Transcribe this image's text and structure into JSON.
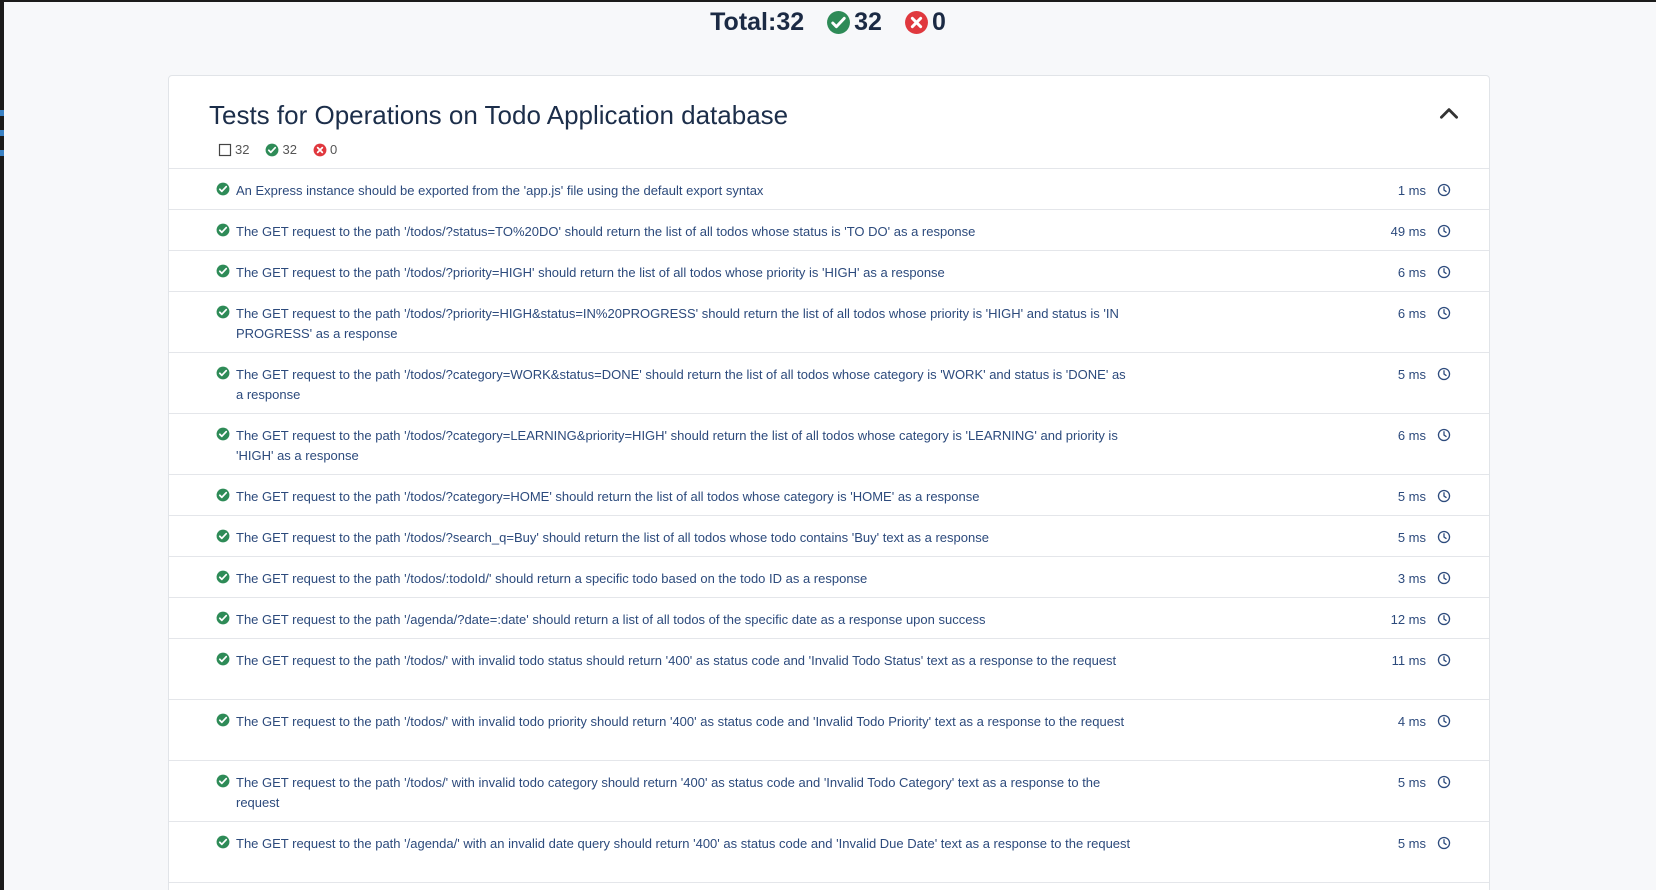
{
  "summary": {
    "total_label": "Total:32",
    "passed": "32",
    "failed": "0"
  },
  "suite": {
    "title": "Tests for Operations on Todo Application database",
    "stats": {
      "total": "32",
      "passed": "32",
      "failed": "0"
    }
  },
  "colors": {
    "pass": "#2e8b57",
    "fail": "#e0383e",
    "title_text": "#1c2e4a",
    "test_text": "#2c4a7c"
  },
  "icons": {
    "pass": "check-circle-icon",
    "fail": "x-circle-icon",
    "total": "square-icon",
    "duration": "clock-icon",
    "collapse": "chevron-up-icon"
  },
  "tests": [
    {
      "title": "An Express instance should be exported from the 'app.js' file using the default export syntax",
      "duration": "1 ms"
    },
    {
      "title": "The GET request to the path '/todos/?status=TO%20DO' should return the list of all todos whose status is 'TO DO' as a response",
      "duration": "49 ms"
    },
    {
      "title": "The GET request to the path '/todos/?priority=HIGH' should return the list of all todos whose priority is 'HIGH' as a response",
      "duration": "6 ms"
    },
    {
      "title": "The GET request to the path '/todos/?priority=HIGH&status=IN%20PROGRESS' should return the list of all todos whose priority is 'HIGH' and status is 'IN PROGRESS' as a response",
      "duration": "6 ms"
    },
    {
      "title": "The GET request to the path '/todos/?category=WORK&status=DONE' should return the list of all todos whose category is 'WORK' and status is 'DONE' as a response",
      "duration": "5 ms"
    },
    {
      "title": "The GET request to the path '/todos/?category=LEARNING&priority=HIGH' should return the list of all todos whose category is 'LEARNING' and priority is 'HIGH' as a response",
      "duration": "6 ms"
    },
    {
      "title": "The GET request to the path '/todos/?category=HOME' should return the list of all todos whose category is 'HOME' as a response",
      "duration": "5 ms"
    },
    {
      "title": "The GET request to the path '/todos/?search_q=Buy' should return the list of all todos whose todo contains 'Buy' text as a response",
      "duration": "5 ms"
    },
    {
      "title": "The GET request to the path '/todos/:todoId/' should return a specific todo based on the todo ID as a response",
      "duration": "3 ms"
    },
    {
      "title": "The GET request to the path '/agenda/?date=:date' should return a list of all todos of the specific date as a response upon success",
      "duration": "12 ms"
    },
    {
      "title": "The GET request to the path '/todos/' with invalid todo status should return '400' as status code and 'Invalid Todo Status' text as a response to the request",
      "duration": "11 ms"
    },
    {
      "title": "The GET request to the path '/todos/' with invalid todo priority should return '400' as status code and 'Invalid Todo Priority' text as a response to the request",
      "duration": "4 ms"
    },
    {
      "title": "The GET request to the path '/todos/' with invalid todo category should return '400' as status code and 'Invalid Todo Category' text as a response to the request",
      "duration": "5 ms"
    },
    {
      "title": "The GET request to the path '/agenda/' with an invalid date query should return '400' as status code and 'Invalid Due Date' text as a response to the request",
      "duration": "5 ms"
    }
  ]
}
